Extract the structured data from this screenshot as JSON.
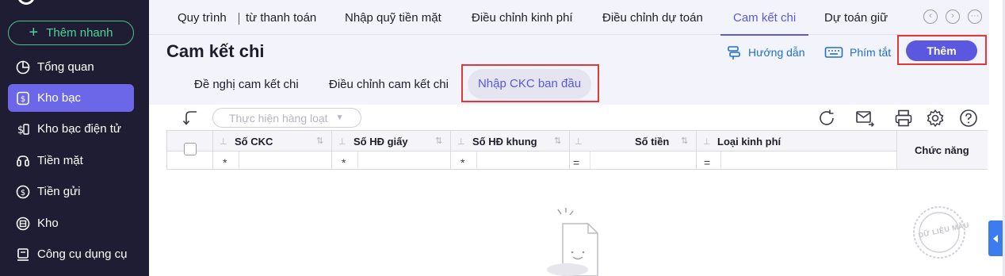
{
  "sidebar": {
    "quick_add_label": "Thêm nhanh",
    "items": [
      {
        "label": "Tổng quan",
        "icon": "pie-chart-icon",
        "active": false
      },
      {
        "label": "Kho bạc",
        "icon": "treasury-icon",
        "active": true
      },
      {
        "label": "Kho bạc điện tử",
        "icon": "e-treasury-icon",
        "active": false
      },
      {
        "label": "Tiền mặt",
        "icon": "cash-icon",
        "active": false
      },
      {
        "label": "Tiền gửi",
        "icon": "deposit-icon",
        "active": false
      },
      {
        "label": "Kho",
        "icon": "warehouse-icon",
        "active": false
      },
      {
        "label": "Công cụ dụng cụ",
        "icon": "tools-icon",
        "active": false
      }
    ]
  },
  "tabs": [
    {
      "label": "Quy trình",
      "active": false
    },
    {
      "label": "từ thanh toán",
      "active": false
    },
    {
      "label": "Nhập quỹ tiền mặt",
      "active": false
    },
    {
      "label": "Điều chỉnh kinh phí",
      "active": false
    },
    {
      "label": "Điều chỉnh dự toán",
      "active": false
    },
    {
      "label": "Cam kết chi",
      "active": true
    },
    {
      "label": "Dự toán giữ",
      "active": false
    }
  ],
  "page": {
    "title": "Cam kết chi",
    "guide_label": "Hướng dẫn",
    "shortcut_label": "Phím tắt",
    "add_label": "Thêm"
  },
  "subtabs": [
    {
      "label": "Đề nghị cam kết chi",
      "active": false
    },
    {
      "label": "Điều chỉnh cam kết chi",
      "active": false
    },
    {
      "label": "Nhập CKC ban đầu",
      "active": true
    }
  ],
  "toolbar": {
    "bulk_action_label": "Thực hiện hàng loạt"
  },
  "grid": {
    "columns": [
      {
        "title": "Số CKC",
        "filter_op": "*"
      },
      {
        "title": "Số HĐ giấy",
        "filter_op": "*"
      },
      {
        "title": "Số HĐ khung",
        "filter_op": "*"
      },
      {
        "title": "Số tiền",
        "filter_op": "="
      },
      {
        "title": "Loại kinh phí",
        "filter_op": "="
      }
    ],
    "function_column": "Chức năng",
    "rows": []
  },
  "watermark": "DỮ LIỆU MẪU",
  "colors": {
    "sidebar_bg": "#1f1d33",
    "accent": "#5b57de",
    "active_nav": "#6b67e8",
    "quick_add": "#4cd496",
    "link": "#1f6fd0",
    "highlight_box": "#e23838"
  }
}
